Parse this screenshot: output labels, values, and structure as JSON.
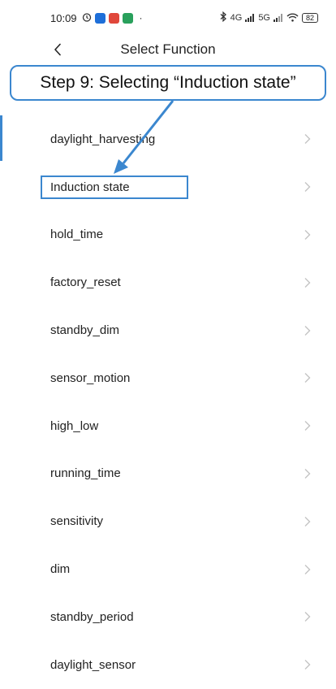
{
  "status_bar": {
    "time": "10:09",
    "dot": "·",
    "signal_4g": "4G",
    "signal_5g": "5G",
    "battery": "82"
  },
  "header": {
    "title": "Select Function"
  },
  "callout": {
    "text": "Step 9: Selecting “Induction state”"
  },
  "functions": [
    {
      "label": "daylight_harvesting"
    },
    {
      "label": "Induction state"
    },
    {
      "label": "hold_time"
    },
    {
      "label": "factory_reset"
    },
    {
      "label": "standby_dim"
    },
    {
      "label": "sensor_motion"
    },
    {
      "label": "high_low"
    },
    {
      "label": "running_time"
    },
    {
      "label": "sensitivity"
    },
    {
      "label": "dim"
    },
    {
      "label": "standby_period"
    },
    {
      "label": "daylight_sensor"
    }
  ],
  "colors": {
    "accent": "#3b87cf",
    "chevron": "#c4c4c4"
  }
}
